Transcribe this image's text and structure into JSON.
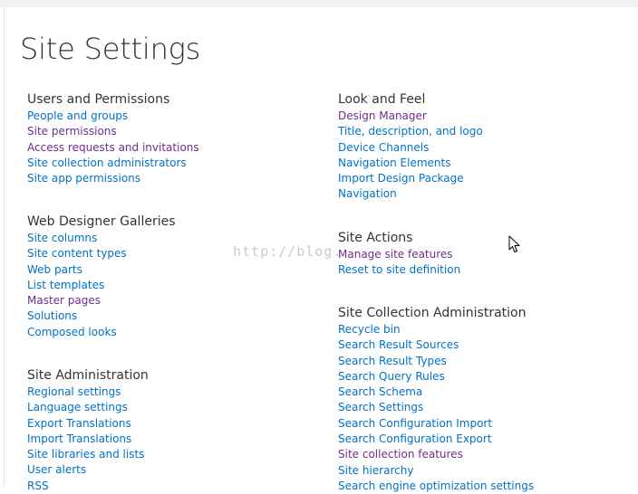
{
  "page_title": "Site Settings",
  "watermark": "http://blog.",
  "colors": {
    "link": "#0072c6",
    "visited_link": "#6f2d8e",
    "heading": "#333333"
  },
  "sections": {
    "users": {
      "heading": "Users and Permissions",
      "items": [
        {
          "label": "People and groups",
          "visited": false
        },
        {
          "label": "Site permissions",
          "visited": true
        },
        {
          "label": "Access requests and invitations",
          "visited": true
        },
        {
          "label": "Site collection administrators",
          "visited": false
        },
        {
          "label": "Site app permissions",
          "visited": false
        }
      ]
    },
    "galleries": {
      "heading": "Web Designer Galleries",
      "items": [
        {
          "label": "Site columns",
          "visited": false
        },
        {
          "label": "Site content types",
          "visited": false
        },
        {
          "label": "Web parts",
          "visited": false
        },
        {
          "label": "List templates",
          "visited": false
        },
        {
          "label": "Master pages",
          "visited": true
        },
        {
          "label": "Solutions",
          "visited": false
        },
        {
          "label": "Composed looks",
          "visited": false
        }
      ]
    },
    "siteadmin": {
      "heading": "Site Administration",
      "items": [
        {
          "label": "Regional settings",
          "visited": false
        },
        {
          "label": "Language settings",
          "visited": false
        },
        {
          "label": "Export Translations",
          "visited": false
        },
        {
          "label": "Import Translations",
          "visited": false
        },
        {
          "label": "Site libraries and lists",
          "visited": false
        },
        {
          "label": "User alerts",
          "visited": false
        },
        {
          "label": "RSS",
          "visited": false
        }
      ]
    },
    "look": {
      "heading": "Look and Feel",
      "items": [
        {
          "label": "Design Manager",
          "visited": true
        },
        {
          "label": "Title, description, and logo",
          "visited": false
        },
        {
          "label": "Device Channels",
          "visited": false
        },
        {
          "label": "Navigation Elements",
          "visited": false
        },
        {
          "label": "Import Design Package",
          "visited": false
        },
        {
          "label": "Navigation",
          "visited": false
        }
      ]
    },
    "actions": {
      "heading": "Site Actions",
      "items": [
        {
          "label": "Manage site features",
          "visited": true
        },
        {
          "label": "Reset to site definition",
          "visited": false
        }
      ]
    },
    "collection": {
      "heading": "Site Collection Administration",
      "items": [
        {
          "label": "Recycle bin",
          "visited": false
        },
        {
          "label": "Search Result Sources",
          "visited": false
        },
        {
          "label": "Search Result Types",
          "visited": false
        },
        {
          "label": "Search Query Rules",
          "visited": false
        },
        {
          "label": "Search Schema",
          "visited": false
        },
        {
          "label": "Search Settings",
          "visited": false
        },
        {
          "label": "Search Configuration Import",
          "visited": false
        },
        {
          "label": "Search Configuration Export",
          "visited": false
        },
        {
          "label": "Site collection features",
          "visited": true
        },
        {
          "label": "Site hierarchy",
          "visited": false
        },
        {
          "label": "Search engine optimization settings",
          "visited": false
        }
      ]
    }
  }
}
